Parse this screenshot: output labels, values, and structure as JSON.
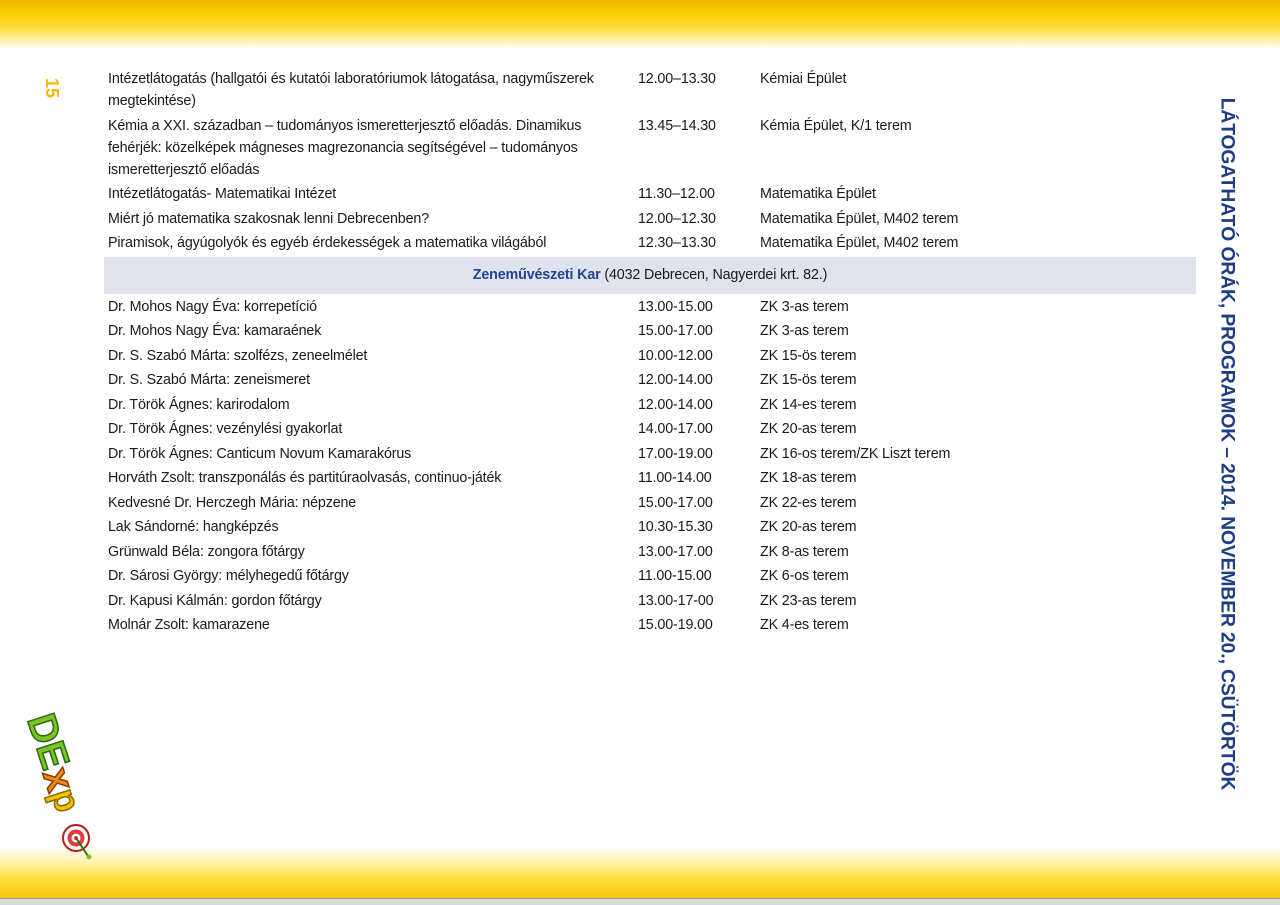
{
  "page_number": "15",
  "side_title": "LÁTOGATHATÓ ÓRÁK, PROGRAMOK – 2014. NOVEMBER 20., CSÜTÖRTÖK",
  "logo": {
    "text": "DExpo",
    "icon": "target-logo"
  },
  "colors": {
    "accent": "#f2b800",
    "title": "#1d3d84",
    "section_bg": "#e0e2ee",
    "section_name": "#1f4594"
  },
  "schedule_top": [
    {
      "title": "Intézetlátogatás (hallgatói és kutatói laboratóriumok látogatása, nagyműszerek megtekintése)",
      "time": "12.00–13.30",
      "place": "Kémiai Épület"
    },
    {
      "title": "Kémia a XXI. században – tudományos ismeretterjesztő előadás. Dinamikus fehérjék: közelképek mágneses magrezonancia segítségével – tudományos ismeretterjesztő előadás",
      "time": "13.45–14.30",
      "place": "Kémia Épület, K/1 terem"
    },
    {
      "title": "Intézetlátogatás- Matematikai Intézet",
      "time": "11.30–12.00",
      "place": "Matematika Épület"
    },
    {
      "title": "Miért jó matematika szakosnak lenni Debrecenben?",
      "time": "12.00–12.30",
      "place": "Matematika Épület, M402 terem"
    },
    {
      "title": "Piramisok, ágyúgolyók és egyéb érdekességek a matematika világából",
      "time": "12.30–13.30",
      "place": "Matematika Épület, M402 terem"
    }
  ],
  "section": {
    "name": "Zeneművészeti Kar",
    "address": "(4032 Debrecen, Nagyerdei krt. 82.)"
  },
  "schedule_music": [
    {
      "title": "Dr. Mohos Nagy Éva: korrepetíció",
      "time": "13.00-15.00",
      "place": "ZK 3-as terem"
    },
    {
      "title": "Dr. Mohos Nagy Éva: kamaraének",
      "time": "15.00-17.00",
      "place": "ZK 3-as terem"
    },
    {
      "title": "Dr. S. Szabó Márta: szolfézs, zeneelmélet",
      "time": "10.00-12.00",
      "place": "ZK 15-ös terem"
    },
    {
      "title": "Dr. S. Szabó Márta: zeneismeret",
      "time": "12.00-14.00",
      "place": "ZK 15-ös terem"
    },
    {
      "title": "Dr. Török Ágnes: karirodalom",
      "time": "12.00-14.00",
      "place": "ZK 14-es terem"
    },
    {
      "title": "Dr. Török Ágnes: vezénylési gyakorlat",
      "time": "14.00-17.00",
      "place": "ZK 20-as terem"
    },
    {
      "title": "Dr. Török Ágnes: Canticum Novum Kamarakórus",
      "time": "17.00-19.00",
      "place": "ZK 16-os terem/ZK Liszt terem"
    },
    {
      "title": "Horváth Zsolt: transzponálás és partitúraolvasás, continuo-játék",
      "time": "11.00-14.00",
      "place": "ZK 18-as terem"
    },
    {
      "title": "Kedvesné Dr. Herczegh Mária: népzene",
      "time": "15.00-17.00",
      "place": "ZK 22-es terem"
    },
    {
      "title": "Lak Sándorné: hangképzés",
      "time": "10.30-15.30",
      "place": "ZK 20-as terem"
    },
    {
      "title": "Grünwald Béla: zongora főtárgy",
      "time": "13.00-17.00",
      "place": "ZK 8-as terem"
    },
    {
      "title": "Dr. Sárosi György: mélyhegedű főtárgy",
      "time": "11.00-15.00",
      "place": "ZK 6-os terem"
    },
    {
      "title": "Dr. Kapusi Kálmán: gordon főtárgy",
      "time": "13.00-17-00",
      "place": "ZK 23-as terem"
    },
    {
      "title": "Molnár Zsolt: kamarazene",
      "time": "15.00-19.00",
      "place": "ZK 4-es terem"
    }
  ]
}
